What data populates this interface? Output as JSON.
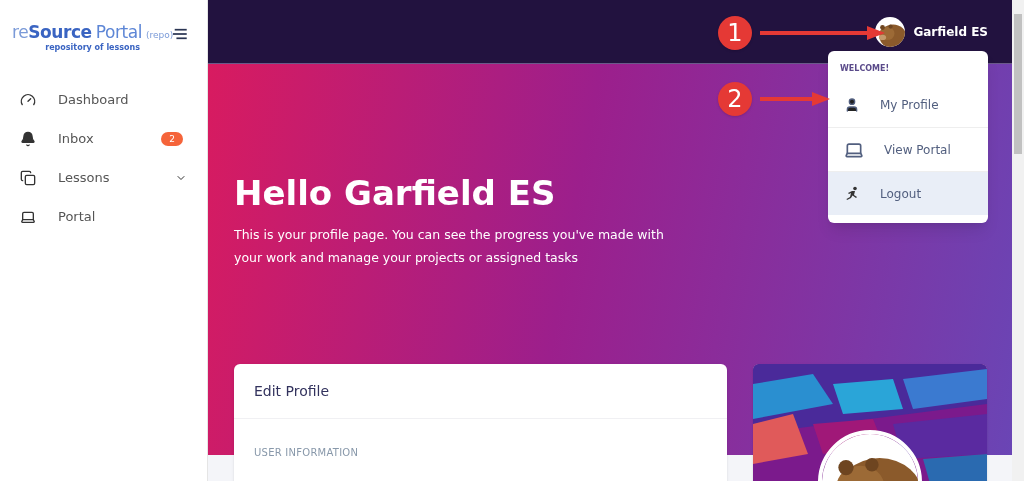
{
  "logo": {
    "prefix": "re",
    "name": "Source",
    "word": "Portal",
    "suffix": "(repo)",
    "tagline": "repository of lessons"
  },
  "sidebar": {
    "items": [
      {
        "kind": "dashboard",
        "label": "Dashboard"
      },
      {
        "kind": "inbox",
        "label": "Inbox",
        "badge": "2"
      },
      {
        "kind": "lessons",
        "label": "Lessons",
        "expanded": false
      },
      {
        "kind": "portal",
        "label": "Portal"
      }
    ]
  },
  "topbar": {
    "user_name": "Garfield ES"
  },
  "user_menu": {
    "heading": "WELCOME!",
    "items": [
      {
        "kind": "profile",
        "label": "My Profile",
        "selected": false
      },
      {
        "kind": "portal",
        "label": "View Portal",
        "selected": false
      },
      {
        "kind": "logout",
        "label": "Logout",
        "selected": true
      }
    ]
  },
  "annotations": [
    {
      "number": "1"
    },
    {
      "number": "2"
    }
  ],
  "hero": {
    "title": "Hello Garfield ES",
    "text": "This is your profile page. You can see the progress you've made with your work and manage your projects or assigned tasks"
  },
  "edit_card": {
    "title": "Edit Profile",
    "section": "USER INFORMATION"
  }
}
